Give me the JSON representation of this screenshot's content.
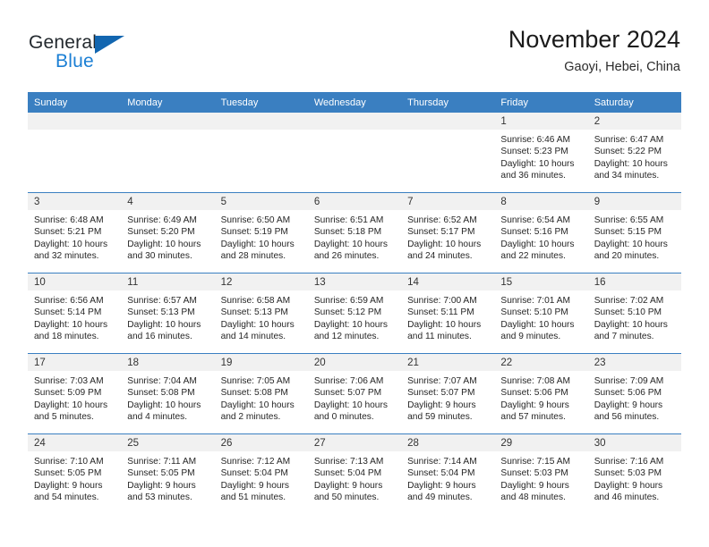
{
  "logo": {
    "word_one": "General",
    "word_two": "Blue",
    "flag_color": "#1266b0",
    "blue_color": "#1b7fd4"
  },
  "header": {
    "title": "November 2024",
    "subtitle": "Gaoyi, Hebei, China"
  },
  "theme": {
    "header_blue": "#3a7fc1",
    "daynum_band": "#f1f1f1"
  },
  "weekdays": [
    "Sunday",
    "Monday",
    "Tuesday",
    "Wednesday",
    "Thursday",
    "Friday",
    "Saturday"
  ],
  "weeks": [
    [
      {
        "day": "",
        "lines": []
      },
      {
        "day": "",
        "lines": []
      },
      {
        "day": "",
        "lines": []
      },
      {
        "day": "",
        "lines": []
      },
      {
        "day": "",
        "lines": []
      },
      {
        "day": "1",
        "lines": [
          "Sunrise: 6:46 AM",
          "Sunset: 5:23 PM",
          "Daylight: 10 hours",
          "and 36 minutes."
        ]
      },
      {
        "day": "2",
        "lines": [
          "Sunrise: 6:47 AM",
          "Sunset: 5:22 PM",
          "Daylight: 10 hours",
          "and 34 minutes."
        ]
      }
    ],
    [
      {
        "day": "3",
        "lines": [
          "Sunrise: 6:48 AM",
          "Sunset: 5:21 PM",
          "Daylight: 10 hours",
          "and 32 minutes."
        ]
      },
      {
        "day": "4",
        "lines": [
          "Sunrise: 6:49 AM",
          "Sunset: 5:20 PM",
          "Daylight: 10 hours",
          "and 30 minutes."
        ]
      },
      {
        "day": "5",
        "lines": [
          "Sunrise: 6:50 AM",
          "Sunset: 5:19 PM",
          "Daylight: 10 hours",
          "and 28 minutes."
        ]
      },
      {
        "day": "6",
        "lines": [
          "Sunrise: 6:51 AM",
          "Sunset: 5:18 PM",
          "Daylight: 10 hours",
          "and 26 minutes."
        ]
      },
      {
        "day": "7",
        "lines": [
          "Sunrise: 6:52 AM",
          "Sunset: 5:17 PM",
          "Daylight: 10 hours",
          "and 24 minutes."
        ]
      },
      {
        "day": "8",
        "lines": [
          "Sunrise: 6:54 AM",
          "Sunset: 5:16 PM",
          "Daylight: 10 hours",
          "and 22 minutes."
        ]
      },
      {
        "day": "9",
        "lines": [
          "Sunrise: 6:55 AM",
          "Sunset: 5:15 PM",
          "Daylight: 10 hours",
          "and 20 minutes."
        ]
      }
    ],
    [
      {
        "day": "10",
        "lines": [
          "Sunrise: 6:56 AM",
          "Sunset: 5:14 PM",
          "Daylight: 10 hours",
          "and 18 minutes."
        ]
      },
      {
        "day": "11",
        "lines": [
          "Sunrise: 6:57 AM",
          "Sunset: 5:13 PM",
          "Daylight: 10 hours",
          "and 16 minutes."
        ]
      },
      {
        "day": "12",
        "lines": [
          "Sunrise: 6:58 AM",
          "Sunset: 5:13 PM",
          "Daylight: 10 hours",
          "and 14 minutes."
        ]
      },
      {
        "day": "13",
        "lines": [
          "Sunrise: 6:59 AM",
          "Sunset: 5:12 PM",
          "Daylight: 10 hours",
          "and 12 minutes."
        ]
      },
      {
        "day": "14",
        "lines": [
          "Sunrise: 7:00 AM",
          "Sunset: 5:11 PM",
          "Daylight: 10 hours",
          "and 11 minutes."
        ]
      },
      {
        "day": "15",
        "lines": [
          "Sunrise: 7:01 AM",
          "Sunset: 5:10 PM",
          "Daylight: 10 hours",
          "and 9 minutes."
        ]
      },
      {
        "day": "16",
        "lines": [
          "Sunrise: 7:02 AM",
          "Sunset: 5:10 PM",
          "Daylight: 10 hours",
          "and 7 minutes."
        ]
      }
    ],
    [
      {
        "day": "17",
        "lines": [
          "Sunrise: 7:03 AM",
          "Sunset: 5:09 PM",
          "Daylight: 10 hours",
          "and 5 minutes."
        ]
      },
      {
        "day": "18",
        "lines": [
          "Sunrise: 7:04 AM",
          "Sunset: 5:08 PM",
          "Daylight: 10 hours",
          "and 4 minutes."
        ]
      },
      {
        "day": "19",
        "lines": [
          "Sunrise: 7:05 AM",
          "Sunset: 5:08 PM",
          "Daylight: 10 hours",
          "and 2 minutes."
        ]
      },
      {
        "day": "20",
        "lines": [
          "Sunrise: 7:06 AM",
          "Sunset: 5:07 PM",
          "Daylight: 10 hours",
          "and 0 minutes."
        ]
      },
      {
        "day": "21",
        "lines": [
          "Sunrise: 7:07 AM",
          "Sunset: 5:07 PM",
          "Daylight: 9 hours",
          "and 59 minutes."
        ]
      },
      {
        "day": "22",
        "lines": [
          "Sunrise: 7:08 AM",
          "Sunset: 5:06 PM",
          "Daylight: 9 hours",
          "and 57 minutes."
        ]
      },
      {
        "day": "23",
        "lines": [
          "Sunrise: 7:09 AM",
          "Sunset: 5:06 PM",
          "Daylight: 9 hours",
          "and 56 minutes."
        ]
      }
    ],
    [
      {
        "day": "24",
        "lines": [
          "Sunrise: 7:10 AM",
          "Sunset: 5:05 PM",
          "Daylight: 9 hours",
          "and 54 minutes."
        ]
      },
      {
        "day": "25",
        "lines": [
          "Sunrise: 7:11 AM",
          "Sunset: 5:05 PM",
          "Daylight: 9 hours",
          "and 53 minutes."
        ]
      },
      {
        "day": "26",
        "lines": [
          "Sunrise: 7:12 AM",
          "Sunset: 5:04 PM",
          "Daylight: 9 hours",
          "and 51 minutes."
        ]
      },
      {
        "day": "27",
        "lines": [
          "Sunrise: 7:13 AM",
          "Sunset: 5:04 PM",
          "Daylight: 9 hours",
          "and 50 minutes."
        ]
      },
      {
        "day": "28",
        "lines": [
          "Sunrise: 7:14 AM",
          "Sunset: 5:04 PM",
          "Daylight: 9 hours",
          "and 49 minutes."
        ]
      },
      {
        "day": "29",
        "lines": [
          "Sunrise: 7:15 AM",
          "Sunset: 5:03 PM",
          "Daylight: 9 hours",
          "and 48 minutes."
        ]
      },
      {
        "day": "30",
        "lines": [
          "Sunrise: 7:16 AM",
          "Sunset: 5:03 PM",
          "Daylight: 9 hours",
          "and 46 minutes."
        ]
      }
    ]
  ]
}
